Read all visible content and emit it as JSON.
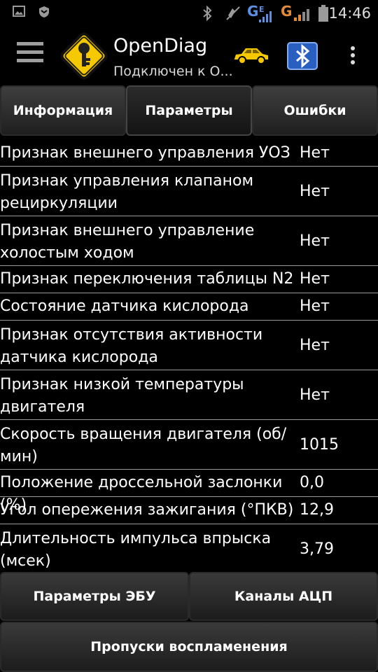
{
  "status_bar": {
    "time": "14:46",
    "net_g1": "G",
    "net_e": "E",
    "net_g2": "G",
    "icons": [
      "image-icon",
      "shield-icon",
      "bluetooth-icon",
      "mute-icon",
      "signal-icon",
      "battery-icon"
    ]
  },
  "app": {
    "title": "OpenDiag",
    "subtitle": "Подключен к О...",
    "colors": {
      "logo_yellow": "#f5c800",
      "car_yellow": "#f5c800",
      "bt_blue": "#2a5fc2"
    }
  },
  "tabs": [
    {
      "label": "Информация",
      "active": false
    },
    {
      "label": "Параметры",
      "active": true
    },
    {
      "label": "Ошибки",
      "active": false
    }
  ],
  "params": [
    {
      "label": "Признак внешнего управления УОЗ",
      "value": "Нет"
    },
    {
      "label": "Признак управления клапаном рециркуляции",
      "value": "Нет"
    },
    {
      "label": "Признак внешнего управление холостым ходом",
      "value": "Нет"
    },
    {
      "label": "Признак переключения таблицы N2",
      "value": "Нет"
    },
    {
      "label": "Состояние датчика кислорода",
      "value": "Нет"
    },
    {
      "label": "Признак отсутствия активности датчика кислорода",
      "value": "Нет"
    },
    {
      "label": "Признак низкой температуры двигателя",
      "value": "Нет"
    },
    {
      "label": "Скорость вращения двигателя (об/мин)",
      "value": "1015"
    },
    {
      "label": "Положение дроссельной заслонки (%)",
      "value": "0,0"
    },
    {
      "label": "Угол опережения зажигания (°ПКВ)",
      "value": "12,9"
    },
    {
      "label": "Длительность импульса впрыска (мсек)",
      "value": "3,79"
    }
  ],
  "buttons": {
    "ecu_params": "Параметры ЭБУ",
    "adc_channels": "Каналы АЦП",
    "misfires": "Пропуски воспламенения"
  }
}
